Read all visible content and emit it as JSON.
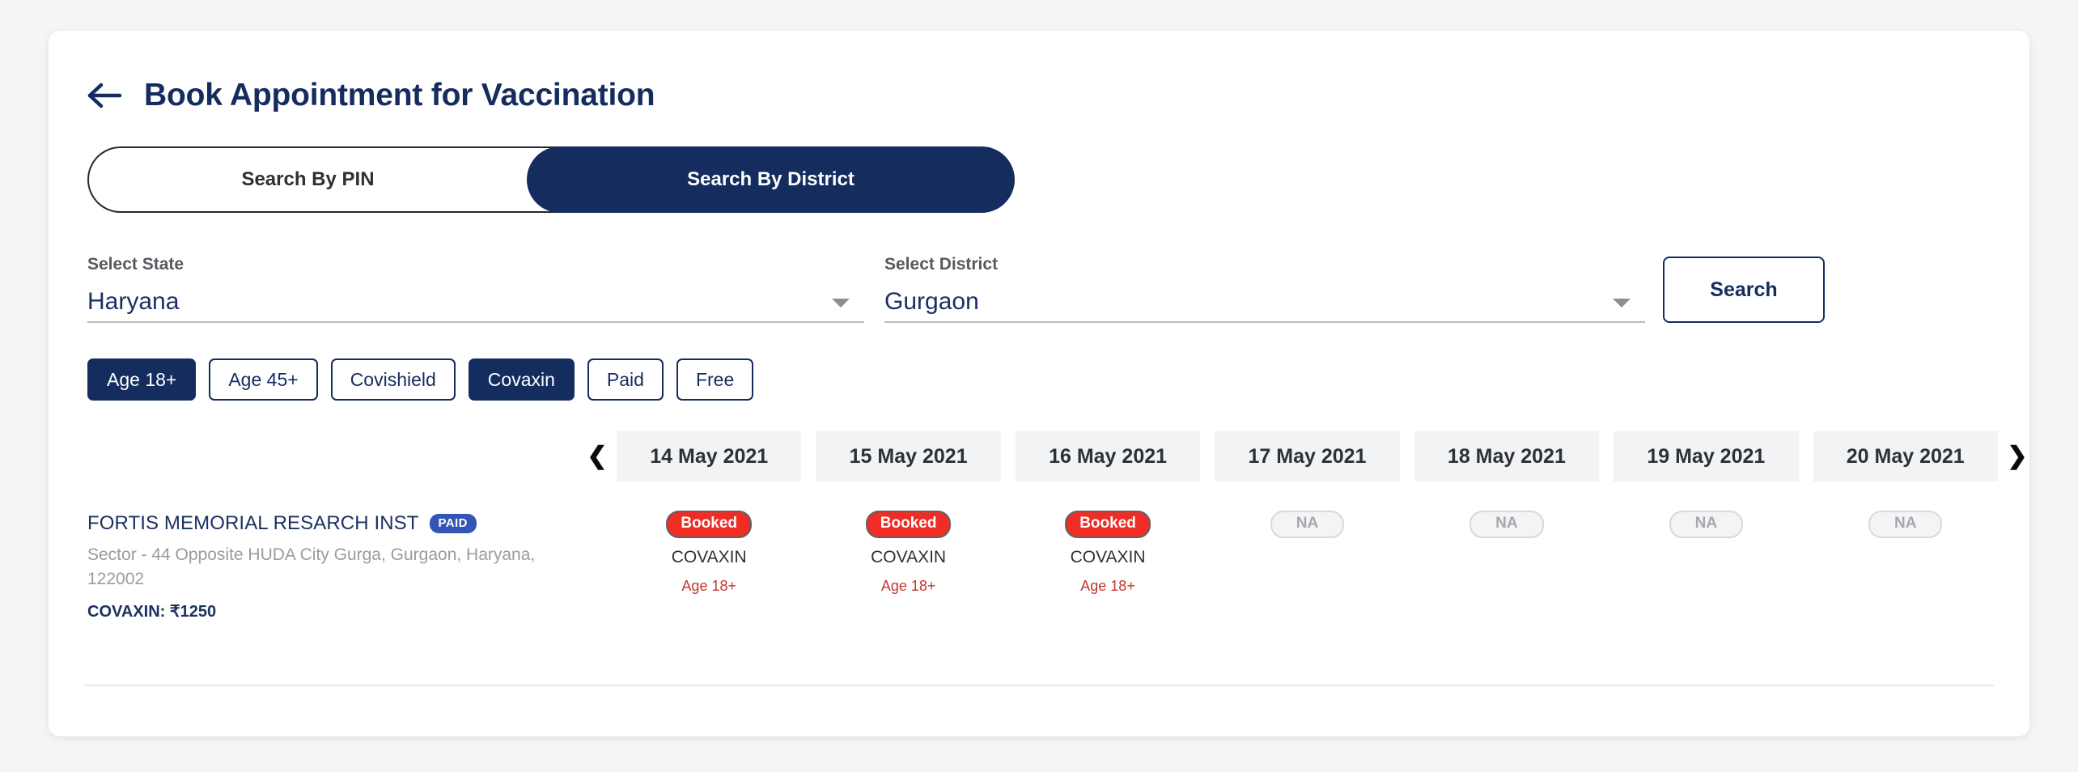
{
  "header": {
    "back_icon": "back-arrow-icon",
    "title": "Book Appointment for Vaccination"
  },
  "search_mode_toggle": {
    "options": [
      "Search By PIN",
      "Search By District"
    ],
    "selected": "Search By District",
    "pin_label": "Search By PIN",
    "district_label": "Search By District"
  },
  "filters": {
    "state": {
      "label": "Select State",
      "value": "Haryana",
      "caret_icon": "chevron-down-icon"
    },
    "district": {
      "label": "Select District",
      "value": "Gurgaon",
      "caret_icon": "chevron-down-icon"
    },
    "search_button": "Search"
  },
  "chips": [
    {
      "label": "Age 18+",
      "active": true
    },
    {
      "label": "Age 45+",
      "active": false
    },
    {
      "label": "Covishield",
      "active": false
    },
    {
      "label": "Covaxin",
      "active": true
    },
    {
      "label": "Paid",
      "active": false
    },
    {
      "label": "Free",
      "active": false
    }
  ],
  "calendar": {
    "prev_icon": "chevron-left-icon",
    "next_icon": "chevron-right-icon",
    "prev_glyph": "❮",
    "next_glyph": "❯",
    "dates": [
      "14 May 2021",
      "15 May 2021",
      "16 May 2021",
      "17 May 2021",
      "18 May 2021",
      "19 May 2021",
      "20 May 2021"
    ]
  },
  "centers": [
    {
      "name": "FORTIS MEMORIAL RESARCH INST",
      "badge": "PAID",
      "address": "Sector - 44 Opposite HUDA City Gurga, Gurgaon, Haryana, 122002",
      "price": "COVAXIN: ₹1250",
      "slots": [
        {
          "status": "Booked",
          "vaccine": "COVAXIN",
          "age": "Age 18+",
          "available": false
        },
        {
          "status": "Booked",
          "vaccine": "COVAXIN",
          "age": "Age 18+",
          "available": false
        },
        {
          "status": "Booked",
          "vaccine": "COVAXIN",
          "age": "Age 18+",
          "available": false
        },
        {
          "status": "NA",
          "vaccine": "",
          "age": "",
          "available": false
        },
        {
          "status": "NA",
          "vaccine": "",
          "age": "",
          "available": false
        },
        {
          "status": "NA",
          "vaccine": "",
          "age": "",
          "available": false
        },
        {
          "status": "NA",
          "vaccine": "",
          "age": "",
          "available": false
        }
      ]
    }
  ],
  "colors": {
    "brand_navy": "#152c5f",
    "booked_red": "#ef2d24",
    "paid_blue": "#3355b5",
    "age_red": "#c0392b",
    "na_gray": "#a6a8ab"
  }
}
